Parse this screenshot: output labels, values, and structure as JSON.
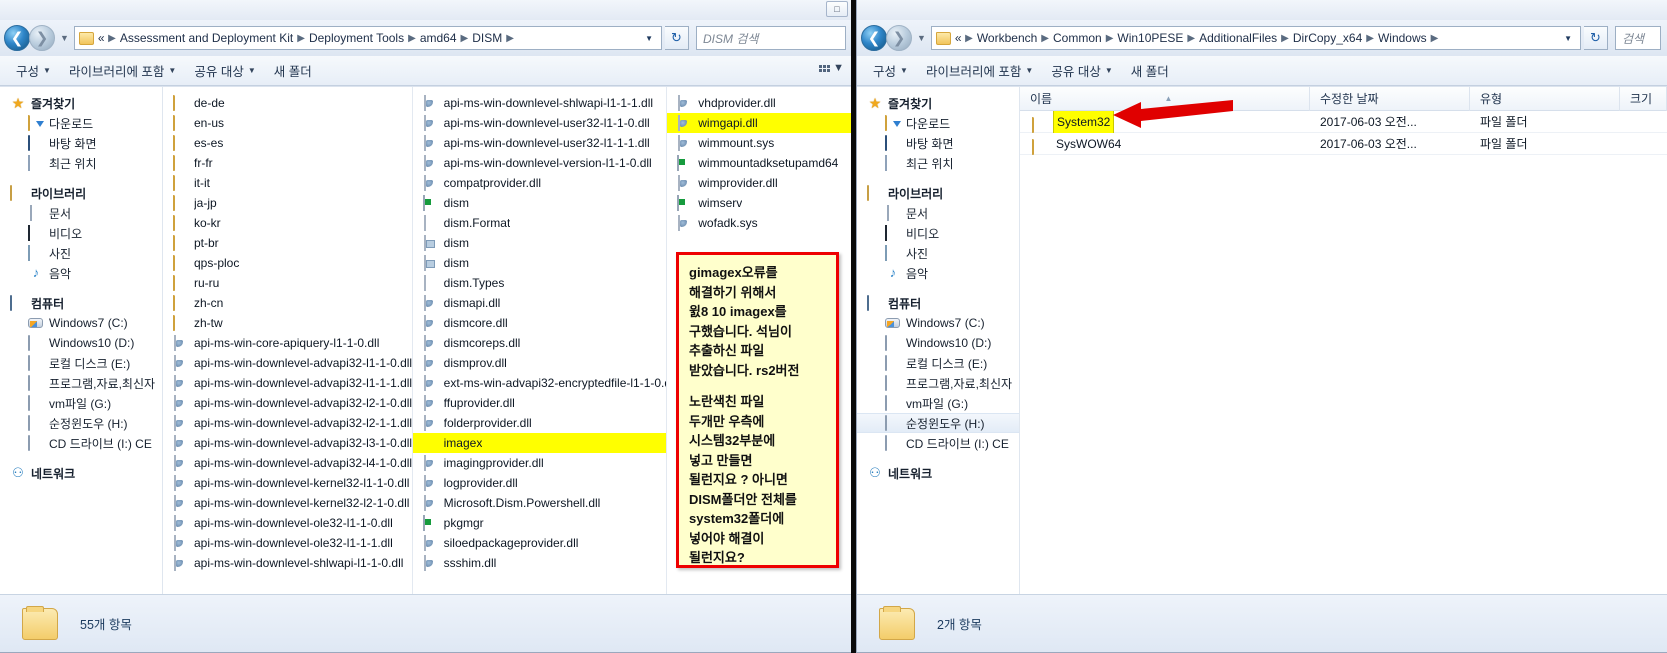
{
  "left_window": {
    "address": {
      "prefix": "«",
      "segments": [
        "Assessment and Deployment Kit",
        "Deployment Tools",
        "amd64",
        "DISM"
      ],
      "dropdown_icon": "chevron-down-icon",
      "refresh_icon": "refresh-icon"
    },
    "search": {
      "placeholder": "DISM 검색"
    },
    "toolbar": {
      "organize": "구성",
      "include_in_library": "라이브러리에 포함",
      "share_with": "공유 대상",
      "new_folder": "새 폴더"
    },
    "nav_pane": [
      {
        "label": "즐겨찾기",
        "icon": "star-icon",
        "level": "head",
        "selected": false
      },
      {
        "label": "다운로드",
        "icon": "downloads-icon",
        "level": "child",
        "selected": false
      },
      {
        "label": "바탕 화면",
        "icon": "desktop-icon",
        "level": "child",
        "selected": false
      },
      {
        "label": "최근 위치",
        "icon": "recent-places-icon",
        "level": "child",
        "selected": false
      },
      {
        "label": "라이브러리",
        "icon": "library-icon",
        "level": "head",
        "selected": false
      },
      {
        "label": "문서",
        "icon": "documents-icon",
        "level": "child",
        "selected": false
      },
      {
        "label": "비디오",
        "icon": "videos-icon",
        "level": "child",
        "selected": false
      },
      {
        "label": "사진",
        "icon": "pictures-icon",
        "level": "child",
        "selected": false
      },
      {
        "label": "음악",
        "icon": "music-icon",
        "level": "child",
        "selected": false
      },
      {
        "label": "컴퓨터",
        "icon": "computer-icon",
        "level": "head",
        "selected": false
      },
      {
        "label": "Windows7 (C:)",
        "icon": "system-drive-icon",
        "level": "child",
        "selected": false
      },
      {
        "label": "Windows10 (D:)",
        "icon": "drive-icon",
        "level": "child",
        "selected": false
      },
      {
        "label": "로컬 디스크 (E:)",
        "icon": "drive-icon",
        "level": "child",
        "selected": false
      },
      {
        "label": "프로그램,자료,최신자",
        "icon": "drive-icon",
        "level": "child",
        "selected": false
      },
      {
        "label": "vm파일 (G:)",
        "icon": "drive-icon",
        "level": "child",
        "selected": false
      },
      {
        "label": "순정윈도우 (H:)",
        "icon": "drive-icon",
        "level": "child",
        "selected": false
      },
      {
        "label": "CD 드라이브 (I:) CE",
        "icon": "cd-drive-icon",
        "level": "child",
        "selected": false
      },
      {
        "label": "네트워크",
        "icon": "network-icon",
        "level": "head",
        "selected": false
      }
    ],
    "columns": [
      [
        {
          "name": "de-de",
          "icon": "folder-icon",
          "highlight": false
        },
        {
          "name": "en-us",
          "icon": "folder-icon",
          "highlight": false
        },
        {
          "name": "es-es",
          "icon": "folder-icon",
          "highlight": false
        },
        {
          "name": "fr-fr",
          "icon": "folder-icon",
          "highlight": false
        },
        {
          "name": "it-it",
          "icon": "folder-icon",
          "highlight": false
        },
        {
          "name": "ja-jp",
          "icon": "folder-icon",
          "highlight": false
        },
        {
          "name": "ko-kr",
          "icon": "folder-icon",
          "highlight": false
        },
        {
          "name": "pt-br",
          "icon": "folder-icon",
          "highlight": false
        },
        {
          "name": "qps-ploc",
          "icon": "folder-icon",
          "highlight": false
        },
        {
          "name": "ru-ru",
          "icon": "folder-icon",
          "highlight": false
        },
        {
          "name": "zh-cn",
          "icon": "folder-icon",
          "highlight": false
        },
        {
          "name": "zh-tw",
          "icon": "folder-icon",
          "highlight": false
        },
        {
          "name": "api-ms-win-core-apiquery-l1-1-0.dll",
          "icon": "dll-icon",
          "highlight": false
        },
        {
          "name": "api-ms-win-downlevel-advapi32-l1-1-0.dll",
          "icon": "dll-icon",
          "highlight": false
        },
        {
          "name": "api-ms-win-downlevel-advapi32-l1-1-1.dll",
          "icon": "dll-icon",
          "highlight": false
        },
        {
          "name": "api-ms-win-downlevel-advapi32-l2-1-0.dll",
          "icon": "dll-icon",
          "highlight": false
        },
        {
          "name": "api-ms-win-downlevel-advapi32-l2-1-1.dll",
          "icon": "dll-icon",
          "highlight": false
        },
        {
          "name": "api-ms-win-downlevel-advapi32-l3-1-0.dll",
          "icon": "dll-icon",
          "highlight": false
        },
        {
          "name": "api-ms-win-downlevel-advapi32-l4-1-0.dll",
          "icon": "dll-icon",
          "highlight": false
        },
        {
          "name": "api-ms-win-downlevel-kernel32-l1-1-0.dll",
          "icon": "dll-icon",
          "highlight": false
        },
        {
          "name": "api-ms-win-downlevel-kernel32-l2-1-0.dll",
          "icon": "dll-icon",
          "highlight": false
        },
        {
          "name": "api-ms-win-downlevel-ole32-l1-1-0.dll",
          "icon": "dll-icon",
          "highlight": false
        },
        {
          "name": "api-ms-win-downlevel-ole32-l1-1-1.dll",
          "icon": "dll-icon",
          "highlight": false
        },
        {
          "name": "api-ms-win-downlevel-shlwapi-l1-1-0.dll",
          "icon": "dll-icon",
          "highlight": false
        }
      ],
      [
        {
          "name": "api-ms-win-downlevel-shlwapi-l1-1-1.dll",
          "icon": "dll-icon",
          "highlight": false
        },
        {
          "name": "api-ms-win-downlevel-user32-l1-1-0.dll",
          "icon": "dll-icon",
          "highlight": false
        },
        {
          "name": "api-ms-win-downlevel-user32-l1-1-1.dll",
          "icon": "dll-icon",
          "highlight": false
        },
        {
          "name": "api-ms-win-downlevel-version-l1-1-0.dll",
          "icon": "dll-icon",
          "highlight": false
        },
        {
          "name": "compatprovider.dll",
          "icon": "dll-icon",
          "highlight": false
        },
        {
          "name": "dism",
          "icon": "exe-icon",
          "highlight": false
        },
        {
          "name": "dism.Format",
          "icon": "xml-icon",
          "highlight": false
        },
        {
          "name": "dism",
          "icon": "config-icon",
          "highlight": false
        },
        {
          "name": "dism",
          "icon": "config-icon",
          "highlight": false
        },
        {
          "name": "dism.Types",
          "icon": "xml-icon",
          "highlight": false
        },
        {
          "name": "dismapi.dll",
          "icon": "dll-icon",
          "highlight": false
        },
        {
          "name": "dismcore.dll",
          "icon": "dll-icon",
          "highlight": false
        },
        {
          "name": "dismcoreps.dll",
          "icon": "dll-icon",
          "highlight": false
        },
        {
          "name": "dismprov.dll",
          "icon": "dll-icon",
          "highlight": false
        },
        {
          "name": "ext-ms-win-advapi32-encryptedfile-l1-1-0.dll",
          "icon": "dll-icon",
          "highlight": false
        },
        {
          "name": "ffuprovider.dll",
          "icon": "dll-icon",
          "highlight": false
        },
        {
          "name": "folderprovider.dll",
          "icon": "dll-icon",
          "highlight": false
        },
        {
          "name": "imagex",
          "icon": "imagex-icon",
          "highlight": true
        },
        {
          "name": "imagingprovider.dll",
          "icon": "dll-icon",
          "highlight": false
        },
        {
          "name": "logprovider.dll",
          "icon": "dll-icon",
          "highlight": false
        },
        {
          "name": "Microsoft.Dism.Powershell.dll",
          "icon": "dll-icon",
          "highlight": false
        },
        {
          "name": "pkgmgr",
          "icon": "exe-icon",
          "highlight": false
        },
        {
          "name": "siloedpackageprovider.dll",
          "icon": "dll-icon",
          "highlight": false
        },
        {
          "name": "ssshim.dll",
          "icon": "dll-icon",
          "highlight": false
        }
      ],
      [
        {
          "name": "vhdprovider.dll",
          "icon": "dll-icon",
          "highlight": false
        },
        {
          "name": "wimgapi.dll",
          "icon": "dll-icon",
          "highlight": true
        },
        {
          "name": "wimmount.sys",
          "icon": "dll-icon",
          "highlight": false
        },
        {
          "name": "wimmountadksetupamd64",
          "icon": "exe-icon",
          "highlight": false
        },
        {
          "name": "wimprovider.dll",
          "icon": "dll-icon",
          "highlight": false
        },
        {
          "name": "wimserv",
          "icon": "exe-icon",
          "highlight": false
        },
        {
          "name": "wofadk.sys",
          "icon": "dll-icon",
          "highlight": false
        }
      ]
    ],
    "status": "55개 항목"
  },
  "annotation_note": {
    "border_color": "#ee0000",
    "background_color": "#ffffcc",
    "paragraph1": [
      "gimagex오류를",
      "해결하기 위해서",
      "윐8 10 imagex를",
      "구했습니다. 석님이",
      "추출하신 파일",
      "받았습니다. rs2버전"
    ],
    "paragraph2": [
      "노란색친 파일",
      "두개만 우측에",
      "시스템32부분에",
      "넣고 만들면",
      "될런지요 ? 아니면",
      "DISM폴더안 전체를",
      "system32폴더에",
      "넣어야 해결이",
      "될런지요?"
    ]
  },
  "right_window": {
    "address": {
      "prefix": "«",
      "segments": [
        "Workbench",
        "Common",
        "Win10PESE",
        "AdditionalFiles",
        "DirCopy_x64",
        "Windows"
      ],
      "dropdown_icon": "chevron-down-icon",
      "refresh_icon": "refresh-icon"
    },
    "search": {
      "placeholder": "검색"
    },
    "toolbar": {
      "organize": "구성",
      "include_in_library": "라이브러리에 포함",
      "share_with": "공유 대상",
      "new_folder": "새 폴더"
    },
    "nav_pane": [
      {
        "label": "즐겨찾기",
        "icon": "star-icon",
        "level": "head",
        "selected": false
      },
      {
        "label": "다운로드",
        "icon": "downloads-icon",
        "level": "child",
        "selected": false
      },
      {
        "label": "바탕 화면",
        "icon": "desktop-icon",
        "level": "child",
        "selected": false
      },
      {
        "label": "최근 위치",
        "icon": "recent-places-icon",
        "level": "child",
        "selected": false
      },
      {
        "label": "라이브러리",
        "icon": "library-icon",
        "level": "head",
        "selected": false
      },
      {
        "label": "문서",
        "icon": "documents-icon",
        "level": "child",
        "selected": false
      },
      {
        "label": "비디오",
        "icon": "videos-icon",
        "level": "child",
        "selected": false
      },
      {
        "label": "사진",
        "icon": "pictures-icon",
        "level": "child",
        "selected": false
      },
      {
        "label": "음악",
        "icon": "music-icon",
        "level": "child",
        "selected": false
      },
      {
        "label": "컴퓨터",
        "icon": "computer-icon",
        "level": "head",
        "selected": false
      },
      {
        "label": "Windows7 (C:)",
        "icon": "system-drive-icon",
        "level": "child",
        "selected": false
      },
      {
        "label": "Windows10 (D:)",
        "icon": "drive-icon",
        "level": "child",
        "selected": false
      },
      {
        "label": "로컬 디스크 (E:)",
        "icon": "drive-icon",
        "level": "child",
        "selected": false
      },
      {
        "label": "프로그램,자료,최신자",
        "icon": "drive-icon",
        "level": "child",
        "selected": false
      },
      {
        "label": "vm파일 (G:)",
        "icon": "drive-icon",
        "level": "child",
        "selected": false
      },
      {
        "label": "순정윈도우 (H:)",
        "icon": "drive-icon",
        "level": "child",
        "selected": true
      },
      {
        "label": "CD 드라이브 (I:) CE",
        "icon": "cd-drive-icon",
        "level": "child",
        "selected": false
      },
      {
        "label": "네트워크",
        "icon": "network-icon",
        "level": "head",
        "selected": false
      }
    ],
    "columns": [
      {
        "key": "name",
        "label": "이름",
        "sorted": true
      },
      {
        "key": "date",
        "label": "수정한 날짜",
        "sorted": false
      },
      {
        "key": "type",
        "label": "유형",
        "sorted": false
      },
      {
        "key": "size",
        "label": "크기",
        "sorted": false
      }
    ],
    "rows": [
      {
        "name": "System32",
        "date": "2017-06-03 오전...",
        "type": "파일 폴더",
        "size": "",
        "icon": "folder-icon",
        "highlight": true
      },
      {
        "name": "SysWOW64",
        "date": "2017-06-03 오전...",
        "type": "파일 폴더",
        "size": "",
        "icon": "folder-icon",
        "highlight": false
      }
    ],
    "status": "2개 항목",
    "arrow": {
      "color": "#e00000",
      "points_to": "System32"
    }
  }
}
